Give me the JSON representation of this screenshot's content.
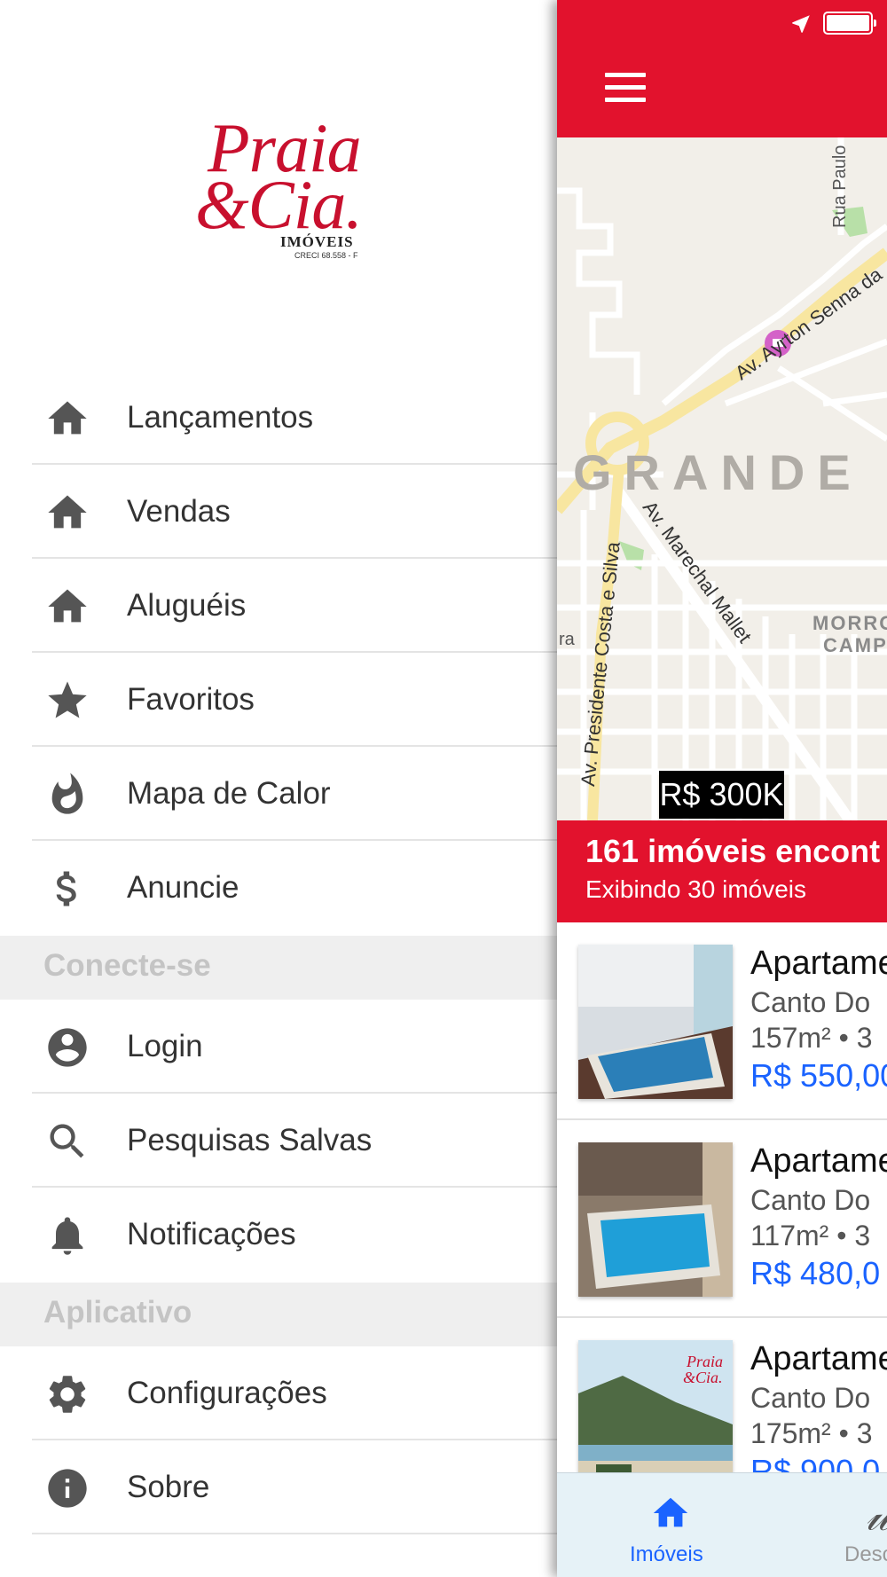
{
  "brand": {
    "logo_line1": "Praia",
    "logo_line2": "&Cia.",
    "logo_line3": "IMÓVEIS",
    "logo_line4": "CRECI 68.558 - F",
    "color": "#c8102e"
  },
  "menu": {
    "items": [
      {
        "label": "Lançamentos",
        "icon": "home-icon"
      },
      {
        "label": "Vendas",
        "icon": "home-icon"
      },
      {
        "label": "Aluguéis",
        "icon": "home-icon"
      },
      {
        "label": "Favoritos",
        "icon": "star-icon"
      },
      {
        "label": "Mapa de Calor",
        "icon": "flame-icon"
      },
      {
        "label": "Anuncie",
        "icon": "dollar-icon"
      }
    ],
    "section_connect": "Conecte-se",
    "connect_items": [
      {
        "label": "Login",
        "icon": "account-icon"
      },
      {
        "label": "Pesquisas Salvas",
        "icon": "search-icon"
      },
      {
        "label": "Notificações",
        "icon": "bell-icon"
      }
    ],
    "section_app": "Aplicativo",
    "app_items": [
      {
        "label": "Configurações",
        "icon": "gear-icon"
      },
      {
        "label": "Sobre",
        "icon": "info-icon"
      }
    ]
  },
  "map": {
    "labels": {
      "rua_paulo": "Rua Paulo",
      "ayrton": "Av. Ayrton Senna da",
      "grande": "GRANDE",
      "marechal": "Av. Marechal Mallet",
      "presidente": "Av. Presidente Costa e Silva",
      "morro": "MORRO",
      "camp": "CAMP",
      "ra": "ra"
    },
    "price_marker": "R$ 300K"
  },
  "results": {
    "count_text": "161 imóveis encont",
    "showing_text": "Exibindo 30 imóveis"
  },
  "listings": [
    {
      "title": "Apartame",
      "neighborhood": "Canto Do",
      "area": "157m² • 3",
      "price": "R$ 550,00"
    },
    {
      "title": "Apartame",
      "neighborhood": "Canto Do",
      "area": "117m² • 3",
      "price": "R$ 480,0"
    },
    {
      "title": "Apartame",
      "neighborhood": "Canto Do",
      "area": "175m² • 3",
      "price": "R$ 900.0"
    }
  ],
  "tabs": [
    {
      "label": "Imóveis",
      "icon": "home-icon",
      "active": true
    },
    {
      "label": "Desc",
      "icon": "script-icon",
      "active": false
    }
  ],
  "colors": {
    "accent": "#e2122d",
    "link_blue": "#1a63ff",
    "section_bg": "#efefef"
  }
}
